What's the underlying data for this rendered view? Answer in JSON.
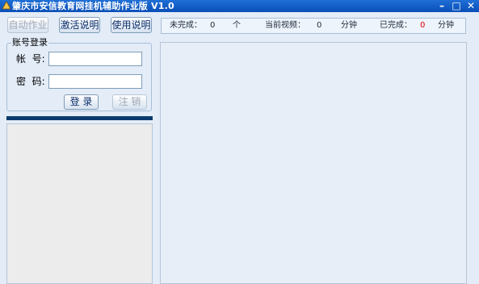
{
  "window": {
    "title": "肇庆市安信教育网挂机辅助作业版  V1.0",
    "minimize_glyph": "–",
    "restore_glyph": "□",
    "close_glyph": "✕"
  },
  "toolbar": {
    "auto_work": "自动作业",
    "activation_info": "激活说明",
    "usage_info": "使用说明"
  },
  "status": {
    "unfinished_label": "未完成：",
    "unfinished_value": "0",
    "unfinished_unit": "个",
    "current_video_label": "当前视频：",
    "current_video_value": "0",
    "current_video_unit": "分钟",
    "finished_label": "已完成：",
    "finished_value": "0",
    "finished_unit": "分钟",
    "finished_color": "#e00000"
  },
  "login": {
    "group_title": "账号登录",
    "account_label": "帐  号:",
    "password_label": "密  码:",
    "account_value": "",
    "password_value": "",
    "login_button": "登 录",
    "logout_button": "注 销"
  },
  "icons": {
    "app_logo": "triangle-logo-icon"
  }
}
